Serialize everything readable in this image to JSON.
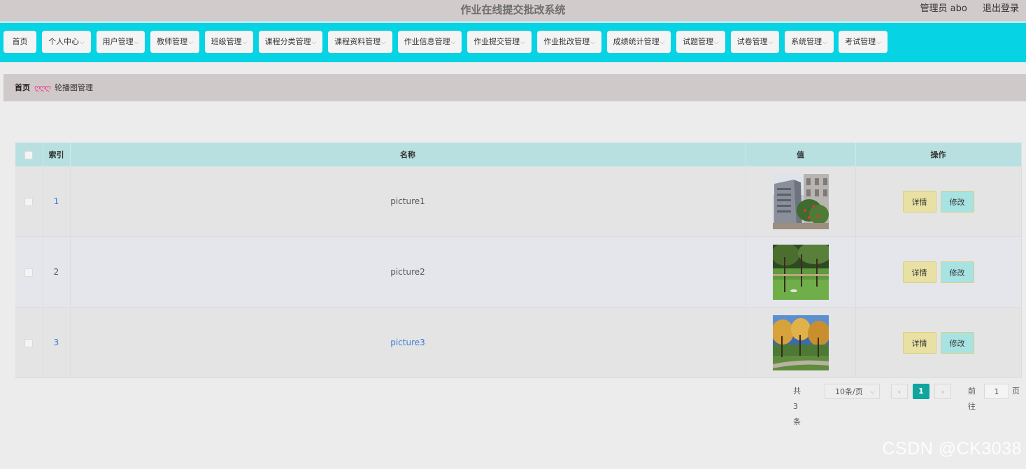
{
  "header": {
    "title": "作业在线提交批改系统",
    "user_label": "管理员 abo",
    "logout_label": "退出登录"
  },
  "nav": {
    "items": [
      {
        "label": "首页",
        "has_dropdown": false
      },
      {
        "label": "个人中心",
        "has_dropdown": true
      },
      {
        "label": "用户管理",
        "has_dropdown": true
      },
      {
        "label": "教师管理",
        "has_dropdown": true
      },
      {
        "label": "班级管理",
        "has_dropdown": true
      },
      {
        "label": "课程分类管理",
        "has_dropdown": true
      },
      {
        "label": "课程资料管理",
        "has_dropdown": true
      },
      {
        "label": "作业信息管理",
        "has_dropdown": true
      },
      {
        "label": "作业提交管理",
        "has_dropdown": true
      },
      {
        "label": "作业批改管理",
        "has_dropdown": true
      },
      {
        "label": "成绩统计管理",
        "has_dropdown": true
      },
      {
        "label": "试题管理",
        "has_dropdown": true
      },
      {
        "label": "试卷管理",
        "has_dropdown": true
      },
      {
        "label": "系统管理",
        "has_dropdown": true
      },
      {
        "label": "考试管理",
        "has_dropdown": true
      }
    ],
    "chevron": "⌵"
  },
  "breadcrumb": {
    "home": "首页",
    "separator": "ღღღ",
    "current": "轮播图管理"
  },
  "table": {
    "columns": {
      "index": "索引",
      "name": "名称",
      "value": "值",
      "actions": "操作"
    },
    "rows": [
      {
        "index": "1",
        "name": "picture1",
        "image": "building-photo",
        "detail_label": "详情",
        "edit_label": "修改"
      },
      {
        "index": "2",
        "name": "picture2",
        "image": "park-lawn-photo",
        "detail_label": "详情",
        "edit_label": "修改"
      },
      {
        "index": "3",
        "name": "picture3",
        "image": "autumn-trees-photo",
        "detail_label": "详情",
        "edit_label": "修改"
      }
    ]
  },
  "pagination": {
    "total_label": "共 3 条",
    "page_size": "10条/页",
    "prev": "‹",
    "current_page": "1",
    "next": "›",
    "goto_prefix": "前往",
    "goto_value": "1",
    "goto_suffix": "页"
  },
  "watermark": "CSDN @CK3038",
  "colors": {
    "navbar": "#06d3e3",
    "table_header": "#b8e0e1",
    "detail_button": "#e9e1a3",
    "edit_button": "#a8e3e3",
    "active_page": "#10a59e"
  }
}
